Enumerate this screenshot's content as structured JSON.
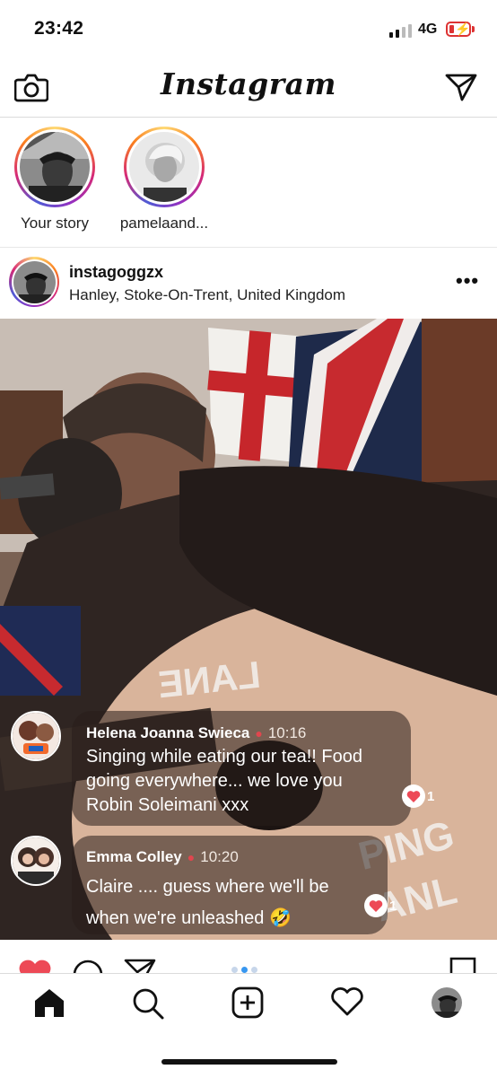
{
  "status_bar": {
    "time": "23:42",
    "network": "4G"
  },
  "header": {
    "logo": "Instagram"
  },
  "stories": [
    {
      "name": "Your story"
    },
    {
      "name": "pamelaand..."
    }
  ],
  "post": {
    "username": "instagoggzx",
    "location": "Hanley, Stoke-On-Trent, United Kingdom"
  },
  "comments": [
    {
      "author": "Helena Joanna Swieca",
      "time": "10:16",
      "lines": [
        "Singing while eating our tea!! Food",
        "going everywhere... we love you",
        "Robin Soleimani xxx"
      ],
      "likes": "1"
    },
    {
      "author": "Emma Colley",
      "time": "10:20",
      "lines": [
        "Claire .... guess where we'll be",
        "when we're unleashed 🤣"
      ],
      "likes": "1"
    }
  ],
  "colors": {
    "like_red": "#ed4956",
    "story_ring_accent": "#d62976",
    "border": "#dbdbdb"
  },
  "tabs": [
    "home-icon",
    "search-icon",
    "new-post-icon",
    "activity-heart-icon",
    "profile-avatar"
  ]
}
